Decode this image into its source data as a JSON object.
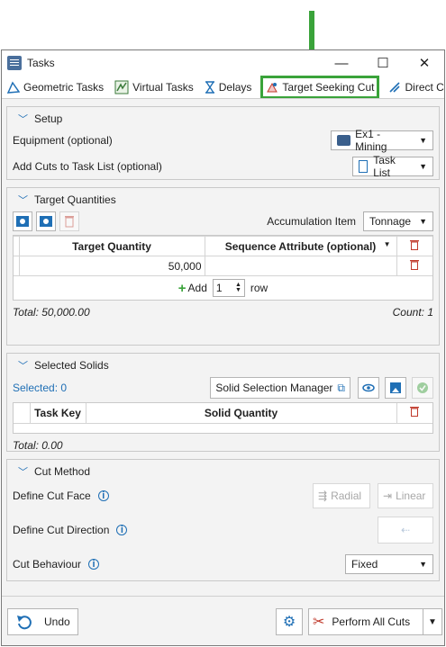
{
  "window": {
    "title": "Tasks"
  },
  "tabs": [
    {
      "label": "Geometric Tasks"
    },
    {
      "label": "Virtual Tasks"
    },
    {
      "label": "Delays"
    },
    {
      "label": "Target Seeking Cut"
    },
    {
      "label": "Direct Cut"
    }
  ],
  "setup": {
    "title": "Setup",
    "equipment_label": "Equipment (optional)",
    "equipment_value": "Ex1 - Mining",
    "add_cuts_label": "Add Cuts to Task List (optional)",
    "add_cuts_value": "Task List"
  },
  "targets": {
    "title": "Target Quantities",
    "accumulation_label": "Accumulation Item",
    "accumulation_value": "Tonnage",
    "col_target": "Target Quantity",
    "col_sequence": "Sequence Attribute (optional)",
    "rows": [
      {
        "target": "50,000",
        "sequence": ""
      }
    ],
    "add_label": "Add",
    "add_count": "1",
    "row_label": "row",
    "total": "Total: 50,000.00",
    "count": "Count: 1"
  },
  "solids": {
    "title": "Selected Solids",
    "selected": "Selected: 0",
    "manager_label": "Solid Selection Manager",
    "col_key": "Task Key",
    "col_quantity": "Solid Quantity",
    "total": "Total: 0.00"
  },
  "cut": {
    "title": "Cut Method",
    "face_label": "Define Cut Face",
    "direction_label": "Define Cut Direction",
    "behaviour_label": "Cut Behaviour",
    "radial": "Radial",
    "linear": "Linear",
    "behaviour_value": "Fixed"
  },
  "footer": {
    "undo": "Undo",
    "perform": "Perform All Cuts"
  },
  "colors": {
    "highlight": "#3aa33a",
    "accent": "#1f6fb5",
    "delete": "#c0392b"
  }
}
